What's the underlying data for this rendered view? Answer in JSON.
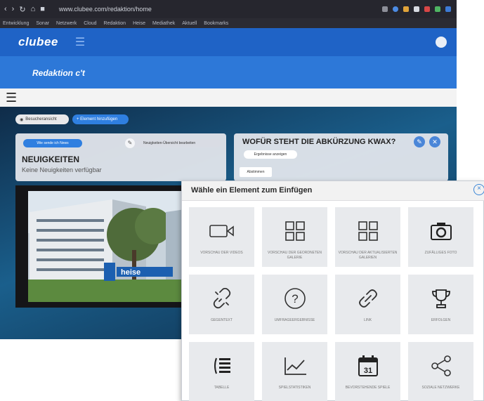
{
  "browser": {
    "url": "www.clubee.com/redaktion/home",
    "bookmarks": [
      "Entwicklung",
      "Sonar",
      "Netzwerk",
      "Cloud",
      "Redaktion",
      "Heise",
      "Mediathek",
      "Aktuell",
      "Bookmarks"
    ]
  },
  "app": {
    "logo": "clubee",
    "club_name": "Redaktion c't"
  },
  "toolbar": {
    "view_button": "Besucheransicht",
    "add_element_button": "+ Element hinzufügen"
  },
  "news_card": {
    "pill": "Wie sende ich News",
    "tool_label": "Neuigkeiten-Übersicht bearbeiten",
    "title": "NEUIGKEITEN",
    "empty_text": "Keine Neuigkeiten verfügbar"
  },
  "quiz_card": {
    "question": "WOFÜR STEHT DIE ABKÜRZUNG KWAX?",
    "show_answer_button": "Ergebnisse anzeigen",
    "vote_button": "Abstimmen"
  },
  "photo": {
    "sign_text": "heise"
  },
  "modal": {
    "title": "Wähle ein Element zum Einfügen",
    "tiles": [
      {
        "label": "Vorschau der Videos",
        "icon": "video-camera-icon"
      },
      {
        "label": "Vorschau der geordneten Galerie",
        "icon": "grid-icon"
      },
      {
        "label": "Vorschau der aktualisierten Galerien",
        "icon": "grid-icon"
      },
      {
        "label": "Zufälliges Foto",
        "icon": "camera-icon"
      },
      {
        "label": "Gegentext",
        "icon": "broken-link-icon"
      },
      {
        "label": "Umfrageergebnisse",
        "icon": "question-icon"
      },
      {
        "label": "Link",
        "icon": "link-icon"
      },
      {
        "label": "Erfolgen",
        "icon": "trophy-icon"
      },
      {
        "label": "Tabelle",
        "icon": "table-icon"
      },
      {
        "label": "Spielstatistiken",
        "icon": "line-chart-icon"
      },
      {
        "label": "Bevorstehende Spiele",
        "icon": "calendar-icon"
      },
      {
        "label": "Soziale Netzwerke",
        "icon": "share-icon"
      }
    ],
    "calendar_day": "31"
  }
}
